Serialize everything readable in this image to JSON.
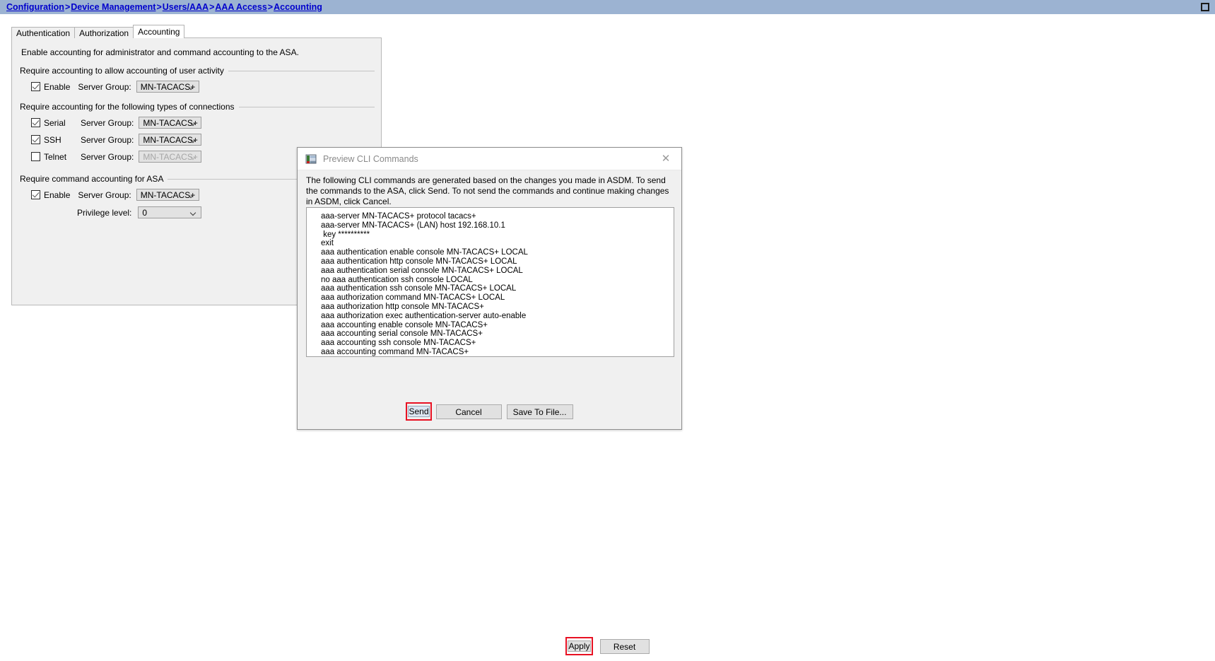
{
  "breadcrumb": {
    "crumbs": [
      "Configuration",
      "Device Management",
      "Users/AAA",
      "AAA Access",
      "Accounting"
    ],
    "separator": ">",
    "restore_icon": "restore-window-icon",
    "background_color": "#9cb3d2",
    "link_color": "#0000cc"
  },
  "tabs": [
    {
      "label": "Authentication",
      "active": false
    },
    {
      "label": "Authorization",
      "active": false
    },
    {
      "label": "Accounting",
      "active": true
    }
  ],
  "panel": {
    "intro": "Enable accounting for administrator and command accounting to the ASA.",
    "sections": [
      {
        "title": "Require accounting to allow accounting of user activity",
        "rows": [
          {
            "checkbox_label": "Enable",
            "checked": true,
            "server_group_label": "Server Group:",
            "server_group_value": "MN-TACACS+",
            "disabled": false
          }
        ]
      },
      {
        "title": "Require accounting for the following types of connections",
        "rows": [
          {
            "checkbox_label": "Serial",
            "checked": true,
            "server_group_label": "Server Group:",
            "server_group_value": "MN-TACACS+",
            "disabled": false
          },
          {
            "checkbox_label": "SSH",
            "checked": true,
            "server_group_label": "Server Group:",
            "server_group_value": "MN-TACACS+",
            "disabled": false
          },
          {
            "checkbox_label": "Telnet",
            "checked": false,
            "server_group_label": "Server Group:",
            "server_group_value": "MN-TACACS+",
            "disabled": true
          }
        ]
      },
      {
        "title": "Require command accounting for ASA",
        "rows": [
          {
            "checkbox_label": "Enable",
            "checked": true,
            "server_group_label": "Server Group:",
            "server_group_value": "MN-TACACS+",
            "disabled": false
          }
        ],
        "privilege": {
          "label": "Privilege level:",
          "value": "0"
        }
      }
    ]
  },
  "dialog": {
    "title": "Preview CLI Commands",
    "icon": "preview-cli-icon",
    "close_icon": "close-icon",
    "description": "The following CLI commands are generated based on the changes you made in ASDM. To send the commands to the ASA, click Send. To not send the commands and continue making changes in ASDM, click Cancel.",
    "commands": [
      "aaa-server MN-TACACS+ protocol tacacs+",
      "aaa-server MN-TACACS+ (LAN) host 192.168.10.1",
      " key **********",
      "exit",
      "aaa authentication enable console MN-TACACS+ LOCAL",
      "aaa authentication http console MN-TACACS+ LOCAL",
      "aaa authentication serial console MN-TACACS+ LOCAL",
      "no aaa authentication ssh console LOCAL",
      "aaa authentication ssh console MN-TACACS+ LOCAL",
      "aaa authorization command MN-TACACS+ LOCAL",
      "aaa authorization http console MN-TACACS+",
      "aaa authorization exec authentication-server auto-enable",
      "aaa accounting enable console MN-TACACS+",
      "aaa accounting serial console MN-TACACS+",
      "aaa accounting ssh console MN-TACACS+",
      "aaa accounting command MN-TACACS+"
    ],
    "buttons": {
      "send": "Send",
      "cancel": "Cancel",
      "save_to_file": "Save To File..."
    }
  },
  "bottom_buttons": {
    "apply": "Apply",
    "reset": "Reset"
  },
  "highlight_color": "#e81123"
}
